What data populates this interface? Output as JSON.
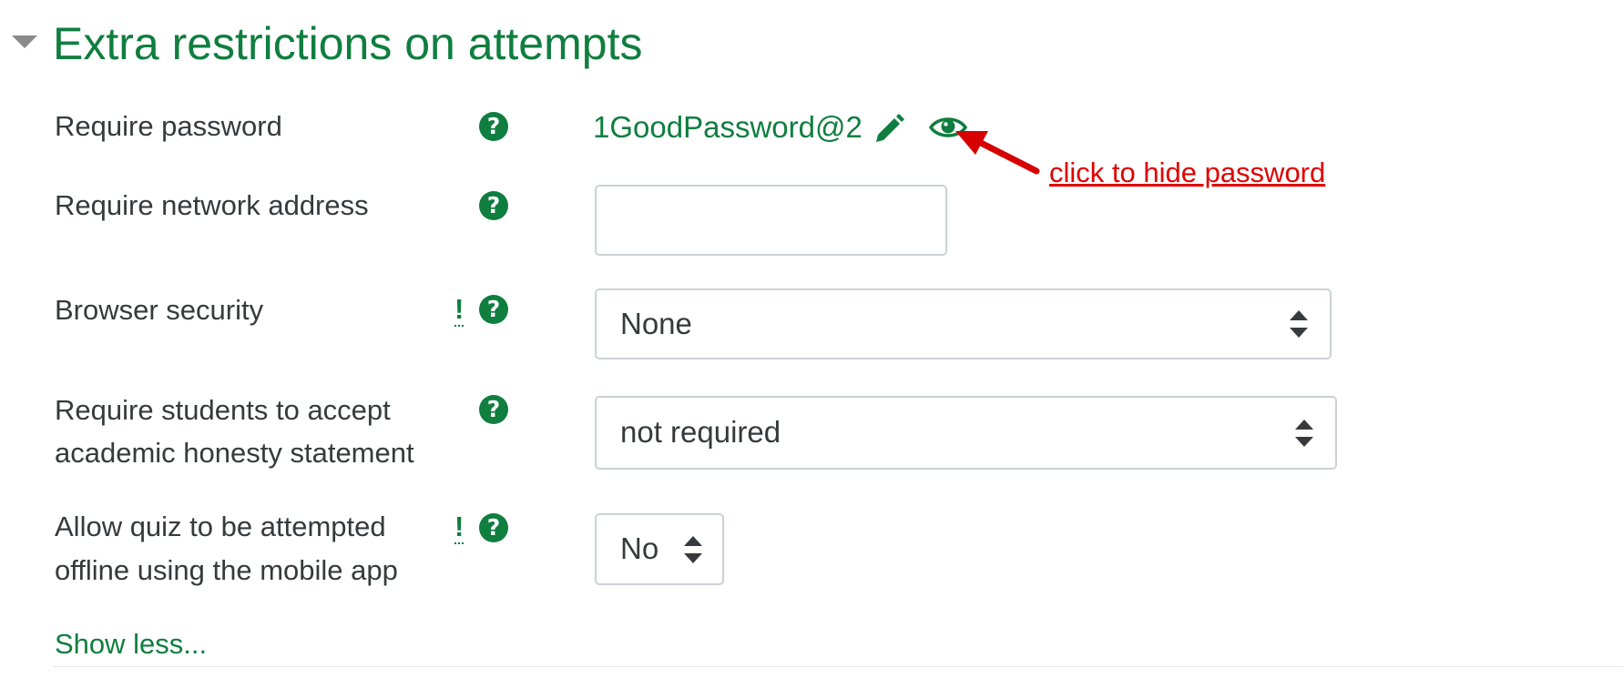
{
  "section": {
    "title": "Extra restrictions on attempts",
    "show_less_label": "Show less..."
  },
  "fields": {
    "password": {
      "label": "Require password",
      "value": "1GoodPassword@2"
    },
    "network_address": {
      "label": "Require network address",
      "value": ""
    },
    "browser_security": {
      "label": "Browser security",
      "selected": "None"
    },
    "honesty": {
      "label_line1": "Require students to accept",
      "label_line2": "academic honesty statement",
      "selected": "not required"
    },
    "offline": {
      "label_line1": "Allow quiz to be attempted",
      "label_line2": "offline using the mobile app",
      "selected": "No"
    }
  },
  "icons": {
    "help": "?",
    "advanced": "!",
    "edit": "pencil-icon",
    "reveal": "eye-icon"
  },
  "annotation": {
    "text": "click to hide password"
  },
  "colors": {
    "accent": "#0f7e3f",
    "annotation": "#e00000",
    "border": "#ccd1d6"
  }
}
